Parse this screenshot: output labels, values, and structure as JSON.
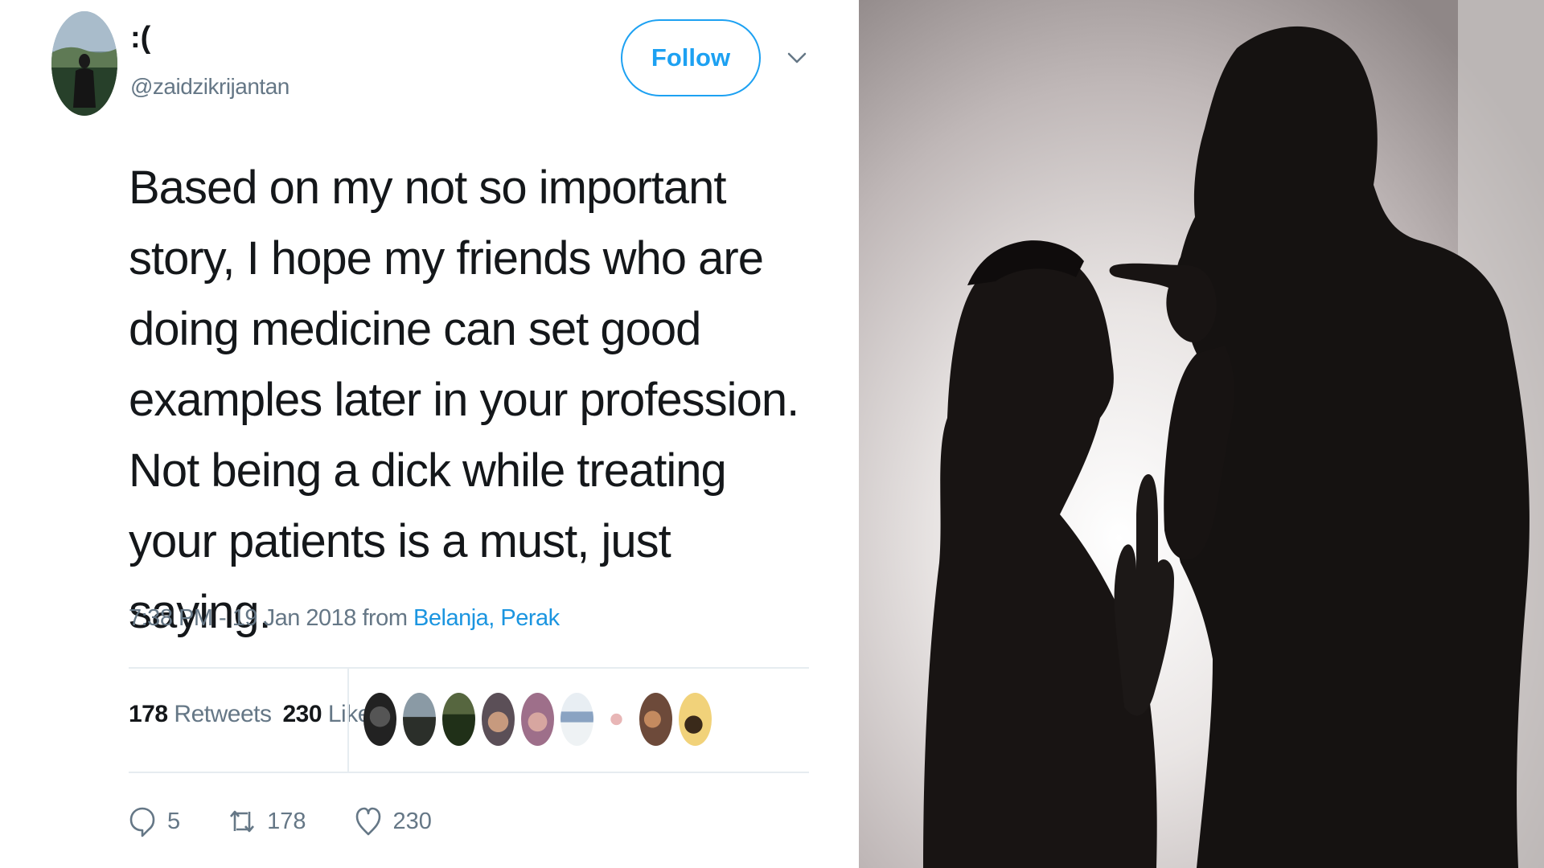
{
  "tweet": {
    "display_name": ":(",
    "handle": "@zaidzikrijantan",
    "follow_label": "Follow",
    "text": "Based on my not so important story, I hope my friends who are doing medicine can set good examples later in your profession. Not being a dick while treating your patients is a must, just saying.",
    "timestamp": "7:38 PM - 19 Jan 2018 from",
    "location": "Belanja, Perak",
    "retweets_count": "178",
    "retweets_label": "Retweets",
    "likes_count": "230",
    "likes_label": "Likes",
    "actions": {
      "reply_count": "5",
      "retweet_count": "178",
      "like_count": "230"
    },
    "icons": {
      "reply": "reply-icon",
      "retweet": "retweet-icon",
      "like": "heart-icon",
      "caret": "chevron-down-icon"
    }
  },
  "colors": {
    "accent": "#1da1f2",
    "link": "#1b95e0",
    "text": "#14171a",
    "muted": "#657786"
  }
}
